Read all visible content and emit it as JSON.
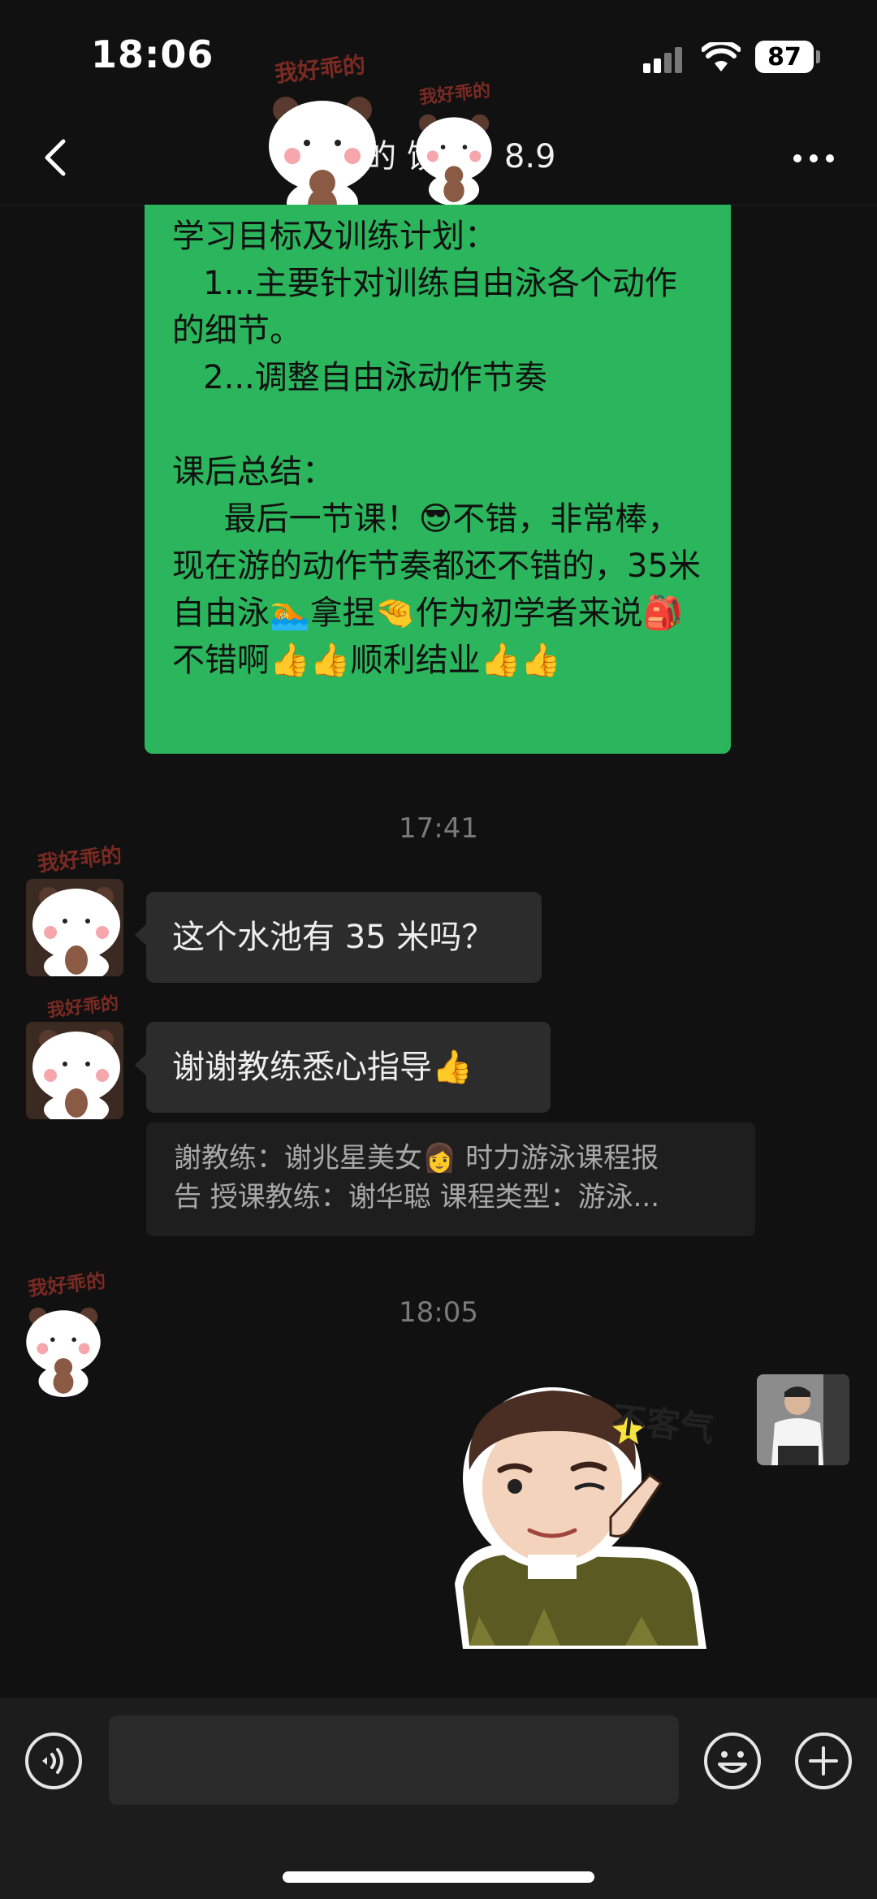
{
  "status_bar": {
    "time": "18:06",
    "battery": "87"
  },
  "header": {
    "title": "喜   的   饺子，8.9"
  },
  "messages": {
    "report_text": "学习目标及训练计划：\n   1...主要针对训练自由泳各个动作的细节。\n   2...调整自由泳动作节奏\n\n课后总结：\n     最后一节课！😎不错，非常棒，现在游的动作节奏都还不错的，35米自由泳🏊拿捏🤏作为初学者来说🎒不错啊👍👍顺利结业👍👍",
    "time_1": "17:41",
    "msg_1": "这个水池有 35 米吗？",
    "msg_2": "谢谢教练悉心指导👍",
    "quote_line_1": "謝教练：谢兆星美女👩 时力游泳课程报",
    "quote_line_2": "告  授课教练：谢华聪 课程类型：游泳...",
    "time_2": "18:05",
    "sticker_text": "不客气"
  },
  "stickers": {
    "bear_label": "我好乖的"
  },
  "input": {
    "placeholder": ""
  },
  "icons": {
    "back": "chevron-left-icon",
    "more": "more-dots-icon",
    "voice": "voice-icon",
    "emoji": "emoji-icon",
    "plus": "plus-icon"
  },
  "colors": {
    "sent_bubble": "#2bb55c",
    "received_bubble": "#2c2c2c",
    "background": "#111111"
  }
}
